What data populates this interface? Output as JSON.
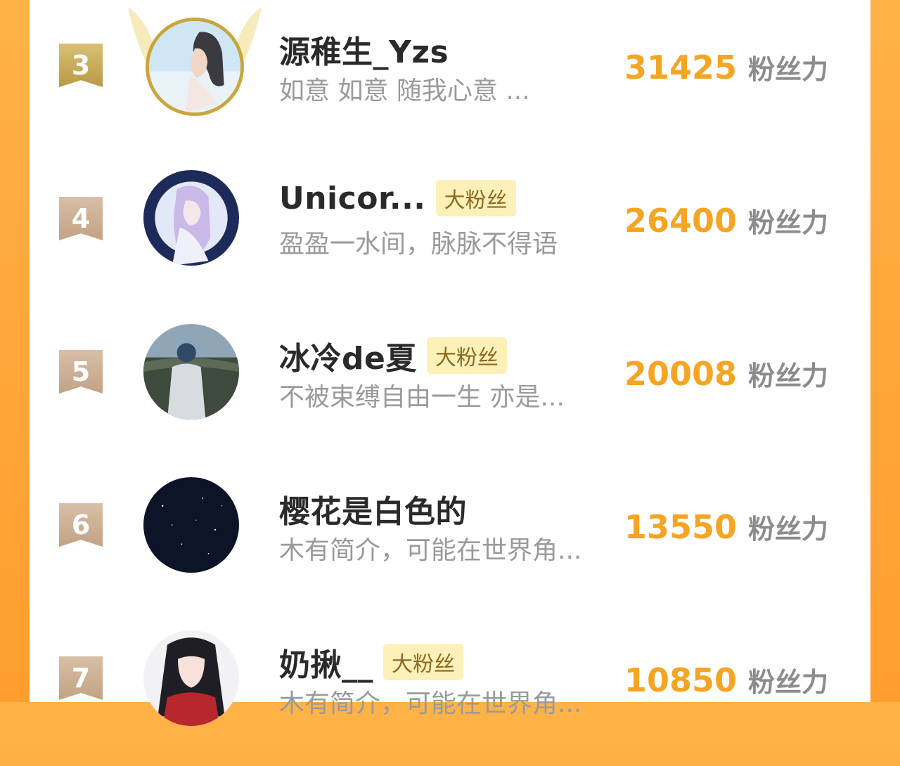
{
  "colors": {
    "background": "#FFA63A",
    "score": "#F5A524",
    "badge_bg": "#FDF0B8",
    "badge_text": "#8A6A1E",
    "rank_gold": "#C9A94F",
    "rank_tan": "#CDB093"
  },
  "score_unit": "粉丝力",
  "ranking": [
    {
      "rank": "3",
      "name": "源稚生_Yzs",
      "badge": "",
      "bio": "如意 如意 随我心意 ...",
      "score": "31425",
      "avatar": "woman-profile-avatar"
    },
    {
      "rank": "4",
      "name": "Unicor...",
      "badge": "大粉丝",
      "bio": "盈盈一水间，脉脉不得语",
      "score": "26400",
      "avatar": "anime-moon-girl-avatar"
    },
    {
      "rank": "5",
      "name": "冰冷de夏",
      "badge": "大粉丝",
      "bio": "不被束缚自由一生 亦是...",
      "score": "20008",
      "avatar": "person-landscape-avatar"
    },
    {
      "rank": "6",
      "name": "樱花是白色的",
      "badge": "",
      "bio": "木有简介，可能在世界角...",
      "score": "13550",
      "avatar": "night-sky-avatar"
    },
    {
      "rank": "7",
      "name": "奶揪__",
      "badge": "大粉丝",
      "bio": "木有简介，可能在世界角...",
      "score": "10850",
      "avatar": "anime-girl-scarf-avatar"
    }
  ]
}
